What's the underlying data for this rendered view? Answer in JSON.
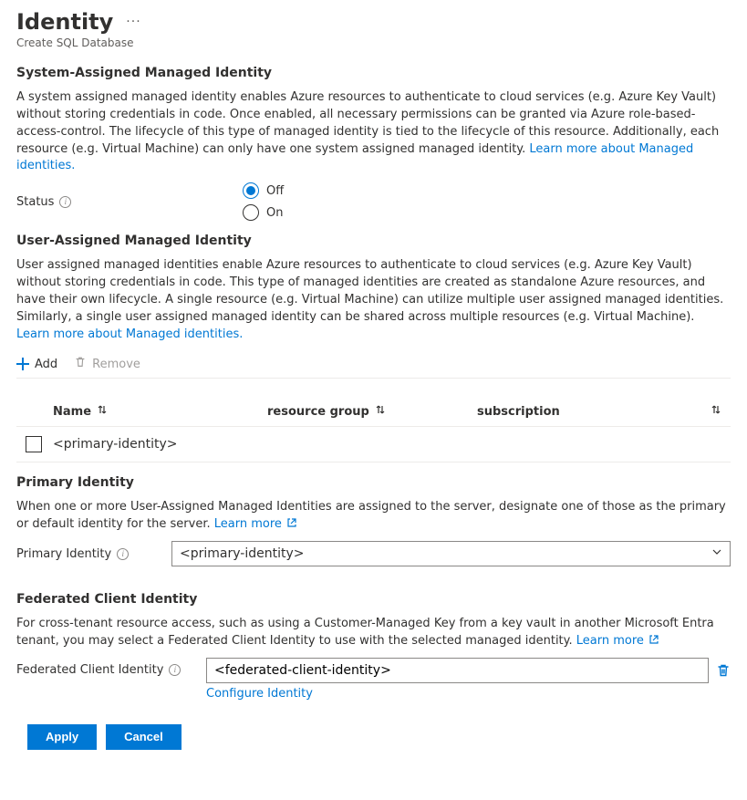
{
  "header": {
    "title": "Identity",
    "subtitle": "Create SQL Database"
  },
  "system_assigned": {
    "heading": "System-Assigned Managed Identity",
    "description": "A system assigned managed identity enables Azure resources to authenticate to cloud services (e.g. Azure Key Vault) without storing credentials in code. Once enabled, all necessary permissions can be granted via Azure role-based-access-control. The lifecycle of this type of managed identity is tied to the lifecycle of this resource. Additionally, each resource (e.g. Virtual Machine) can only have one system assigned managed identity.",
    "learn_more": "Learn more about Managed identities.",
    "status_label": "Status",
    "options": {
      "off": "Off",
      "on": "On"
    }
  },
  "user_assigned": {
    "heading": "User-Assigned Managed Identity",
    "description": "User assigned managed identities enable Azure resources to authenticate to cloud services (e.g. Azure Key Vault) without storing credentials in code. This type of managed identities are created as standalone Azure resources, and have their own lifecycle. A single resource (e.g. Virtual Machine) can utilize multiple user assigned managed identities. Similarly, a single user assigned managed identity can be shared across multiple resources (e.g. Virtual Machine).",
    "learn_more": "Learn more about Managed identities.",
    "toolbar": {
      "add": "Add",
      "remove": "Remove"
    },
    "columns": {
      "name": "Name",
      "resource_group": "resource group",
      "subscription": "subscription"
    },
    "rows": [
      {
        "name": "<primary-identity>",
        "resource_group": "",
        "subscription": ""
      }
    ]
  },
  "primary_identity": {
    "heading": "Primary Identity",
    "description": "When one or more User-Assigned Managed Identities are assigned to the server, designate one of those as the primary or default identity for the server.",
    "learn_more": "Learn more",
    "label": "Primary Identity",
    "value": "<primary-identity>"
  },
  "federated": {
    "heading": "Federated Client Identity",
    "description": "For cross-tenant resource access, such as using a Customer-Managed Key from a key vault in another Microsoft Entra tenant, you may select a Federated Client Identity to use with the selected managed identity.",
    "learn_more": "Learn more",
    "label": "Federated Client Identity",
    "value": "<federated-client-identity>",
    "configure": "Configure Identity"
  },
  "footer": {
    "apply": "Apply",
    "cancel": "Cancel"
  }
}
